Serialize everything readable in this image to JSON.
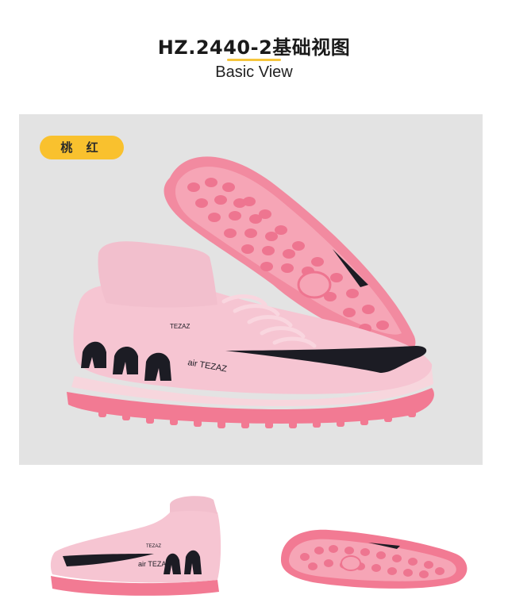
{
  "header": {
    "title": "HZ.2440-2基础视图",
    "subtitle": "Basic View"
  },
  "main": {
    "color_badge": "桃  红",
    "brand_print_upper": "TEZAZ",
    "brand_print_side": "air TEZAZ"
  },
  "thumbnails": {
    "left_brand_print": "air TEZAZ",
    "left_upper_print": "TEZAZ"
  },
  "colors": {
    "badge": "#f9c12e",
    "panel": "#e3e3e3",
    "shoe_pink": "#f6c5d2",
    "sole_pink": "#f27a93",
    "swoosh": "#1c1c24"
  }
}
